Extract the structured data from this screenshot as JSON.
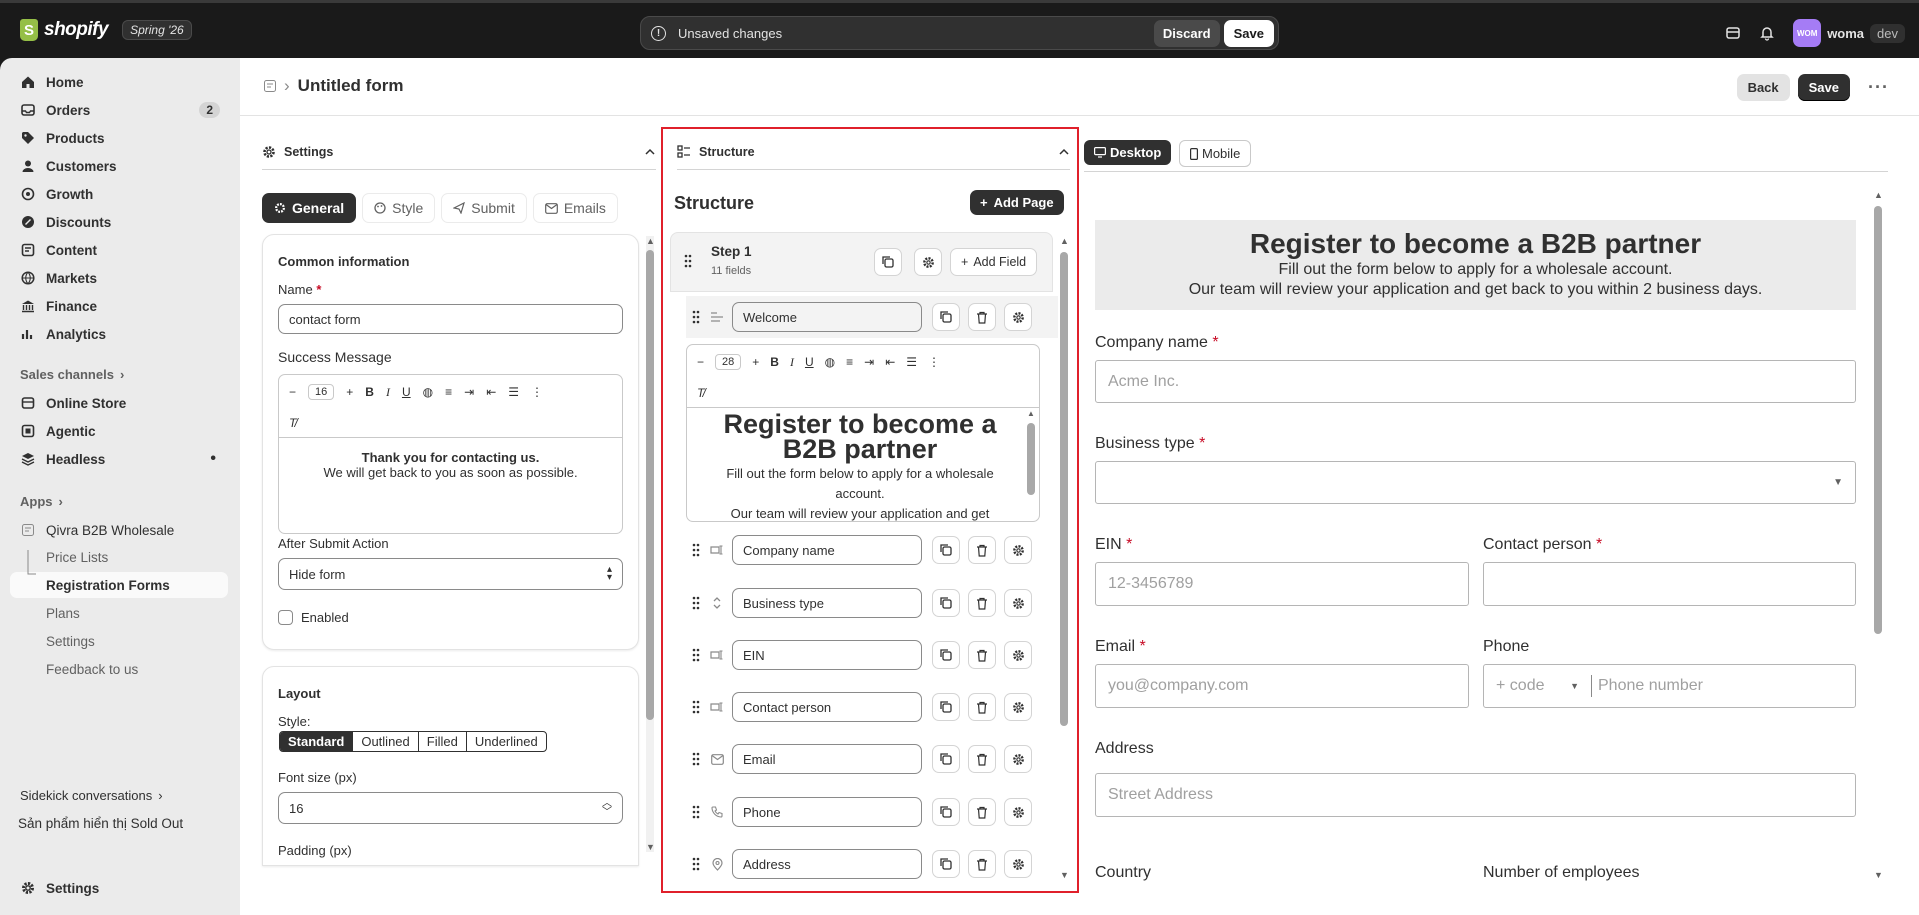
{
  "topbar": {
    "logo_text": "shopify",
    "edition": "Spring '26",
    "unsaved_text": "Unsaved changes",
    "discard_label": "Discard",
    "save_label": "Save",
    "avatar_initials": "WOM",
    "user_name": "woma",
    "env_badge": "dev"
  },
  "sidebar": {
    "items": [
      {
        "label": "Home",
        "icon": "home-icon"
      },
      {
        "label": "Orders",
        "icon": "inbox-icon",
        "badge": "2"
      },
      {
        "label": "Products",
        "icon": "tag-icon"
      },
      {
        "label": "Customers",
        "icon": "person-icon"
      },
      {
        "label": "Growth",
        "icon": "growth-icon"
      },
      {
        "label": "Discounts",
        "icon": "discount-icon"
      },
      {
        "label": "Content",
        "icon": "content-icon"
      },
      {
        "label": "Markets",
        "icon": "globe-icon"
      },
      {
        "label": "Finance",
        "icon": "bank-icon"
      },
      {
        "label": "Analytics",
        "icon": "chart-icon"
      }
    ],
    "sales_channels_label": "Sales channels",
    "channels": [
      {
        "label": "Online Store",
        "icon": "store-icon"
      },
      {
        "label": "Agentic",
        "icon": "agentic-icon"
      },
      {
        "label": "Headless",
        "icon": "headless-icon"
      }
    ],
    "apps_label": "Apps",
    "app_name": "Qivra B2B Wholesale",
    "app_subitems": [
      "Price Lists",
      "Registration Forms",
      "Plans",
      "Settings",
      "Feedback to us"
    ],
    "sidekick_label": "Sidekick conversations",
    "sidekick_item": "Sản phẩm hiển thị Sold Out",
    "settings_label": "Settings"
  },
  "page": {
    "title": "Untitled form",
    "back_label": "Back",
    "save_label": "Save"
  },
  "settings_panel": {
    "header": "Settings",
    "tabs": [
      "General",
      "Style",
      "Submit",
      "Emails"
    ],
    "common_info_title": "Common information",
    "name_label": "Name",
    "name_value": "contact form",
    "success_label": "Success Message",
    "font_size_value": "16",
    "success_line1": "Thank you for contacting us.",
    "success_line2": "We will get back to you as soon as possible.",
    "after_submit_label": "After Submit Action",
    "after_submit_value": "Hide form",
    "enabled_label": "Enabled",
    "layout_title": "Layout",
    "style_label": "Style:",
    "style_options": [
      "Standard",
      "Outlined",
      "Filled",
      "Underlined"
    ],
    "fontsize_label": "Font size (px)",
    "fontsize_value": "16",
    "padding_label": "Padding (px)"
  },
  "structure_panel": {
    "header": "Structure",
    "title": "Structure",
    "add_page_label": "Add Page",
    "step_title": "Step 1",
    "step_count": "11 fields",
    "add_field_label": "Add Field",
    "welcome_field": "Welcome",
    "editor_font_size": "28",
    "editor_heading": "Register to become a B2B partner",
    "editor_text1": "Fill out the form below to apply for a wholesale account.",
    "editor_text2": "Our team will review your application and get",
    "fields": [
      {
        "label": "Company name",
        "icon": "text-field-icon"
      },
      {
        "label": "Business type",
        "icon": "select-icon"
      },
      {
        "label": "EIN",
        "icon": "text-field-icon"
      },
      {
        "label": "Contact person",
        "icon": "text-field-icon"
      },
      {
        "label": "Email",
        "icon": "email-icon"
      },
      {
        "label": "Phone",
        "icon": "phone-icon"
      },
      {
        "label": "Address",
        "icon": "location-icon"
      }
    ]
  },
  "preview": {
    "desktop_label": "Desktop",
    "mobile_label": "Mobile",
    "heading": "Register to become a B2B partner",
    "sub1": "Fill out the form below to apply for a wholesale account.",
    "sub2": "Our team will review your application and get back to you within 2 business days.",
    "company_label": "Company name",
    "company_placeholder": "Acme Inc.",
    "business_label": "Business type",
    "ein_label": "EIN",
    "ein_placeholder": "12-3456789",
    "contact_label": "Contact person",
    "email_label": "Email",
    "email_placeholder": "you@company.com",
    "phone_label": "Phone",
    "phone_code": "+ code",
    "phone_placeholder": "Phone number",
    "address_label": "Address",
    "address_placeholder": "Street Address",
    "country_label": "Country",
    "employees_label": "Number of employees"
  }
}
